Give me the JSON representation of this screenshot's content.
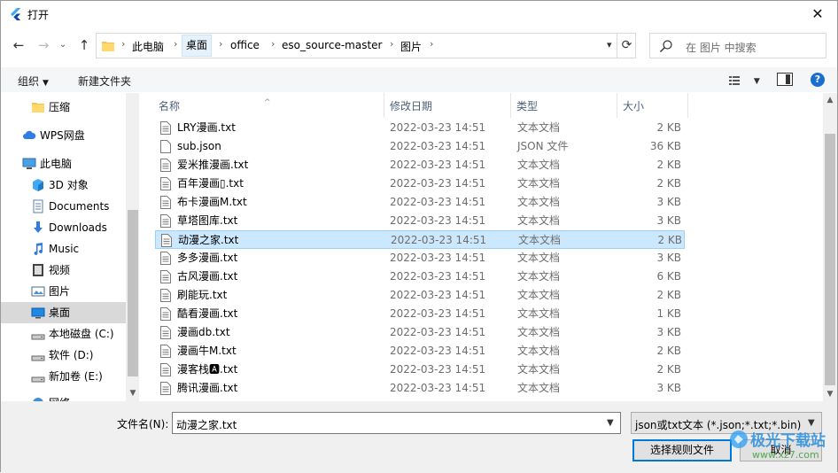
{
  "window": {
    "title": "打开",
    "close_glyph": "✕"
  },
  "nav": {
    "back_glyph": "←",
    "forward_glyph": "→",
    "recent_glyph": "⌄",
    "up_glyph": "↑",
    "breadcrumbs": [
      "此电脑",
      "桌面",
      "office",
      "eso_source-master",
      "图片"
    ],
    "sep_glyph": "›",
    "refresh_glyph": "⟳",
    "search_placeholder": "在 图片 中搜索"
  },
  "toolbar": {
    "organize": "组织",
    "new_folder": "新建文件夹",
    "help": "?"
  },
  "sidebar": {
    "items": [
      {
        "label": "压缩",
        "icon": "folder-icon"
      },
      {
        "label": "WPS网盘",
        "icon": "cloud-icon"
      },
      {
        "label": "此电脑",
        "icon": "computer-icon"
      },
      {
        "label": "3D 对象",
        "icon": "3d-objects-icon"
      },
      {
        "label": "Documents",
        "icon": "documents-icon"
      },
      {
        "label": "Downloads",
        "icon": "download-icon"
      },
      {
        "label": "Music",
        "icon": "music-icon"
      },
      {
        "label": "视频",
        "icon": "video-icon"
      },
      {
        "label": "图片",
        "icon": "pictures-icon"
      },
      {
        "label": "桌面",
        "icon": "desktop-icon"
      },
      {
        "label": "本地磁盘 (C:)",
        "icon": "drive-icon"
      },
      {
        "label": "软件 (D:)",
        "icon": "drive-icon"
      },
      {
        "label": "新加卷 (E:)",
        "icon": "drive-icon"
      },
      {
        "label": "网络",
        "icon": "network-icon"
      }
    ]
  },
  "columns": {
    "name": "名称",
    "date": "修改日期",
    "type": "类型",
    "size": "大小"
  },
  "files": [
    {
      "name": "LRY漫画.txt",
      "date": "2022-03-23 14:51",
      "type": "文本文档",
      "size": "2 KB"
    },
    {
      "name": "sub.json",
      "date": "2022-03-23 14:51",
      "type": "JSON 文件",
      "size": "36 KB"
    },
    {
      "name": "爱米推漫画.txt",
      "date": "2022-03-23 14:51",
      "type": "文本文档",
      "size": "2 KB"
    },
    {
      "name": "百年漫画▯.txt",
      "date": "2022-03-23 14:51",
      "type": "文本文档",
      "size": "2 KB"
    },
    {
      "name": "布卡漫画M.txt",
      "date": "2022-03-23 14:51",
      "type": "文本文档",
      "size": "3 KB"
    },
    {
      "name": "草塔图库.txt",
      "date": "2022-03-23 14:51",
      "type": "文本文档",
      "size": "3 KB"
    },
    {
      "name": "动漫之家.txt",
      "date": "2022-03-23 14:51",
      "type": "文本文档",
      "size": "2 KB"
    },
    {
      "name": "多多漫画.txt",
      "date": "2022-03-23 14:51",
      "type": "文本文档",
      "size": "3 KB"
    },
    {
      "name": "古风漫画.txt",
      "date": "2022-03-23 14:51",
      "type": "文本文档",
      "size": "6 KB"
    },
    {
      "name": "刷能玩.txt",
      "date": "2022-03-23 14:51",
      "type": "文本文档",
      "size": "2 KB"
    },
    {
      "name": "酷看漫画.txt",
      "date": "2022-03-23 14:51",
      "type": "文本文档",
      "size": "1 KB"
    },
    {
      "name": "漫画db.txt",
      "date": "2022-03-23 14:51",
      "type": "文本文档",
      "size": "3 KB"
    },
    {
      "name": "漫画牛M.txt",
      "date": "2022-03-23 14:51",
      "type": "文本文档",
      "size": "2 KB"
    },
    {
      "name": "漫客栈🅰.txt",
      "date": "2022-03-23 14:51",
      "type": "文本文档",
      "size": "2 KB"
    },
    {
      "name": "腾讯漫画.txt",
      "date": "2022-03-23 14:51",
      "type": "文本文档",
      "size": "3 KB"
    }
  ],
  "selected_index": 6,
  "footer": {
    "filename_label": "文件名(N):",
    "filename_value": "动漫之家.txt",
    "filetype_value": "json或txt文本 (*.json;*.txt;*.bin)",
    "open_button": "选择规则文件",
    "cancel_button": "取消"
  },
  "watermark": {
    "line1": "极光下载站",
    "line2": "www.xz7.com"
  },
  "colors": {
    "accent": "#0078d7",
    "selected_row": "#cce8ff",
    "help_blue": "#1a6ed2"
  }
}
